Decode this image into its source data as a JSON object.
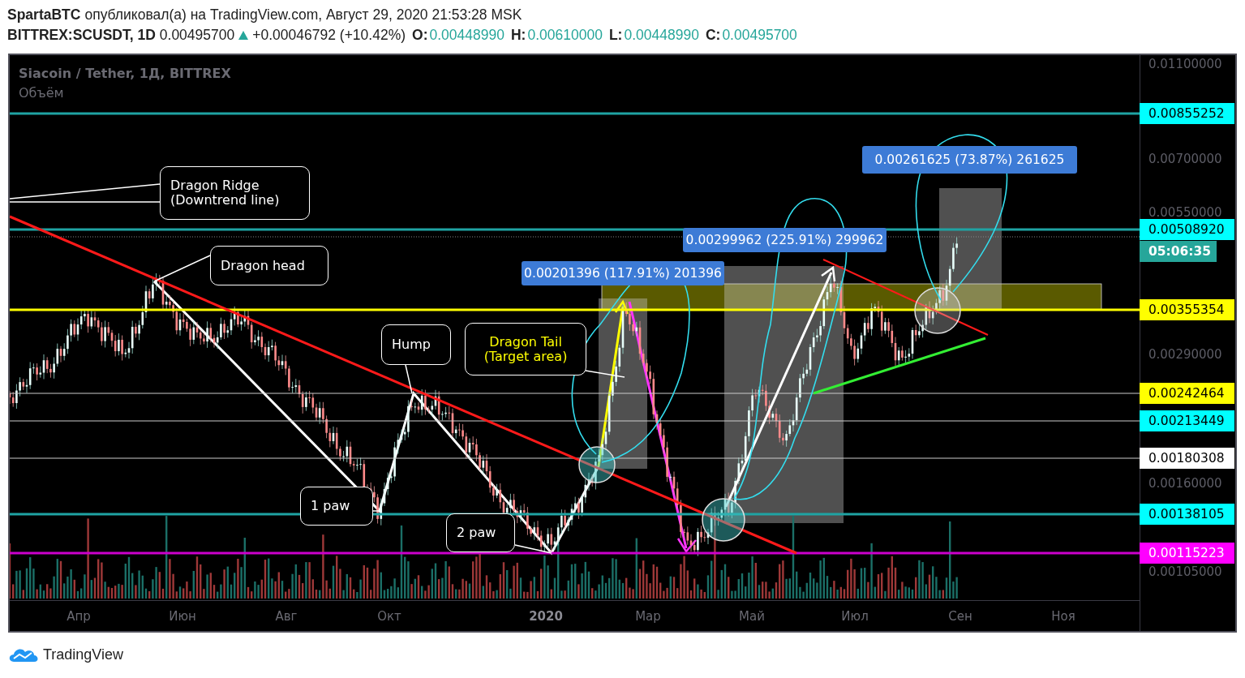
{
  "header": {
    "author": "SpartaBTC",
    "published": "опубликовал(а) на TradingView.com, Август 29, 2020 21:53:28 MSK",
    "symbol": "BITTREX:SCUSDT, 1D",
    "price": "0.00495700",
    "change": "+0.00046792 (+10.42%)",
    "ohlc": [
      {
        "label": "O:",
        "value": "0.00448990"
      },
      {
        "label": "H:",
        "value": "0.00610000"
      },
      {
        "label": "L:",
        "value": "0.00448990"
      },
      {
        "label": "C:",
        "value": "0.00495700"
      }
    ]
  },
  "chart": {
    "title": "Siacoin / Tether, 1Д, BITTREX",
    "indicator": "Объём",
    "callouts": [
      {
        "kind": "note",
        "lines": [
          "Dragon Ridge",
          "(Downtrend line)"
        ]
      },
      {
        "kind": "note",
        "lines": [
          "Dragon head"
        ]
      },
      {
        "kind": "note",
        "lines": [
          "Hump"
        ]
      },
      {
        "kind": "target",
        "lines": [
          "Dragon Tail",
          "(Target area)"
        ]
      },
      {
        "kind": "note",
        "lines": [
          "1 paw"
        ]
      },
      {
        "kind": "note",
        "lines": [
          "2 paw"
        ]
      }
    ],
    "measures": [
      "0.00201396 (117.91%) 201396",
      "0.00299962 (225.91%) 299962",
      "0.00261625 (73.87%) 261625"
    ],
    "price_ticks": [
      "0.01100000",
      "0.00700000",
      "0.00550000",
      "0.00290000",
      "0.00160000",
      "0.00105000"
    ],
    "price_labels": [
      {
        "value": "0.00855252",
        "color": "#00ffff"
      },
      {
        "value": "0.00508920",
        "color": "#00ffff"
      },
      {
        "value": "0.00355354",
        "color": "#ffff00"
      },
      {
        "value": "0.00242464",
        "color": "#ffff00"
      },
      {
        "value": "0.00213449",
        "color": "#00ffff"
      },
      {
        "value": "0.00180308",
        "color": "#ffffff"
      },
      {
        "value": "0.00138105",
        "color": "#00ffff"
      },
      {
        "value": "0.00115223",
        "color": "#ff00ff"
      }
    ],
    "countdown": "05:06:35",
    "time_ticks": [
      {
        "label": "Апр",
        "kind": "month"
      },
      {
        "label": "Июн",
        "kind": "month"
      },
      {
        "label": "Авг",
        "kind": "month"
      },
      {
        "label": "Окт",
        "kind": "month"
      },
      {
        "label": "2020",
        "kind": "year"
      },
      {
        "label": "Мар",
        "kind": "month"
      },
      {
        "label": "Май",
        "kind": "month"
      },
      {
        "label": "Июл",
        "kind": "month"
      },
      {
        "label": "Сен",
        "kind": "month"
      },
      {
        "label": "Ноя",
        "kind": "month"
      }
    ]
  },
  "footer": {
    "brand": "TradingView"
  }
}
